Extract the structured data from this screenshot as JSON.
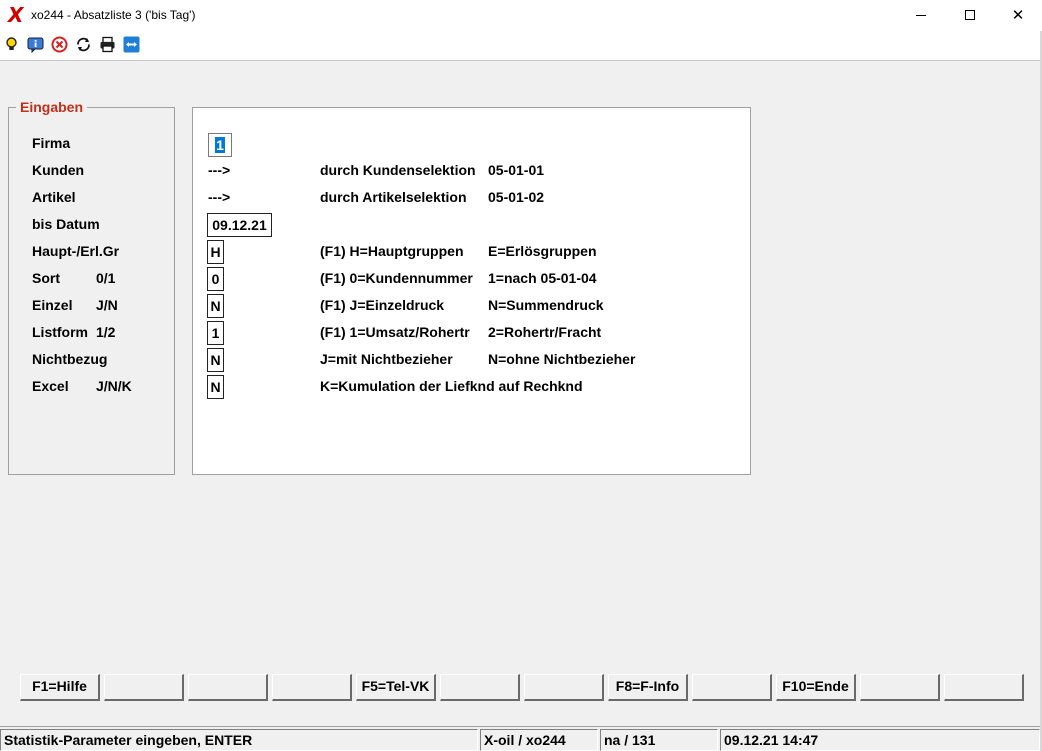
{
  "window": {
    "title": "xo244 - Absatzliste 3 ('bis Tag')",
    "app_icon": "X",
    "close_glyph": "✕"
  },
  "toolbar": {
    "icons": [
      "lightbulb-icon",
      "info-icon",
      "stop-icon",
      "refresh-icon",
      "print-icon",
      "remote-icon"
    ]
  },
  "group": {
    "title": "Eingaben",
    "labels": {
      "firma": "Firma",
      "kunden": "Kunden",
      "artikel": "Artikel",
      "bis_datum": "bis Datum",
      "haupt": "Haupt-/Erl.Gr",
      "sort": "Sort",
      "sort_opts": "0/1",
      "einzel": "Einzel",
      "einzel_opts": "J/N",
      "listform": "Listform",
      "listform_opts": "1/2",
      "nichtbezug": "Nichtbezug",
      "excel": "Excel",
      "excel_opts": "J/N/K"
    }
  },
  "fields": {
    "firma": "1",
    "kunden_arrow": "--->",
    "artikel_arrow": "--->",
    "bis_datum": "09.12.21",
    "haupt": "H",
    "sort": "0",
    "einzel": "N",
    "listform": "1",
    "nichtbezug": "N",
    "excel": "N"
  },
  "hints": {
    "kunden_a": "durch Kundenselektion",
    "kunden_b": "05-01-01",
    "artikel_a": "durch Artikelselektion",
    "artikel_b": "05-01-02",
    "haupt_a": "(F1) H=Hauptgruppen",
    "haupt_b": "E=Erlösgruppen",
    "sort_a": "(F1) 0=Kundennummer",
    "sort_b": "1=nach 05-01-04",
    "einzel_a": "(F1) J=Einzeldruck",
    "einzel_b": "N=Summendruck",
    "listform_a": "(F1) 1=Umsatz/Rohertr",
    "listform_b": "2=Rohertr/Fracht",
    "nichtbezug_a": "J=mit Nichtbezieher",
    "nichtbezug_b": "N=ohne Nichtbezieher",
    "excel_a": "K=Kumulation der Liefknd auf Rechknd"
  },
  "function_keys": [
    "F1=Hilfe",
    "",
    "",
    "",
    "F5=Tel-VK",
    "",
    "",
    "F8=F-Info",
    "",
    "F10=Ende",
    "",
    ""
  ],
  "status": {
    "message": "Statistik-Parameter eingeben, ENTER",
    "program": "X-oil / xo244",
    "user": "na / 131",
    "datetime": "09.12.21 14:47"
  }
}
